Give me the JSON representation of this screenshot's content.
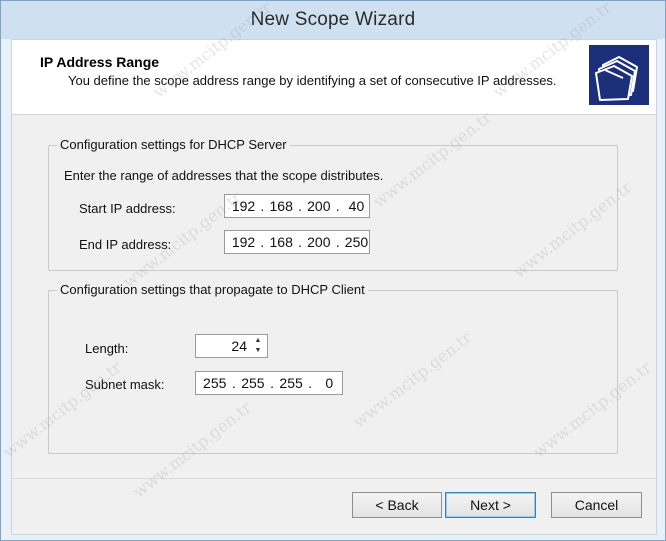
{
  "window": {
    "title": "New Scope Wizard"
  },
  "header": {
    "title": "IP Address Range",
    "subtitle": "You define the scope address range by identifying a set of consecutive IP addresses.",
    "icon": "folders-icon"
  },
  "server_group": {
    "legend": "Configuration settings for DHCP Server",
    "instruction": "Enter the range of addresses that the scope distributes.",
    "start_label": "Start IP address:",
    "start_ip": [
      "192",
      "168",
      "200",
      "40"
    ],
    "end_label": "End IP address:",
    "end_ip": [
      "192",
      "168",
      "200",
      "250"
    ]
  },
  "client_group": {
    "legend": "Configuration settings that propagate to DHCP Client",
    "length_label": "Length:",
    "length_value": "24",
    "mask_label": "Subnet mask:",
    "mask": [
      "255",
      "255",
      "255",
      "0"
    ]
  },
  "buttons": {
    "back": "< Back",
    "next": "Next >",
    "cancel": "Cancel"
  },
  "watermark": "www.mcitp.gen.tr"
}
